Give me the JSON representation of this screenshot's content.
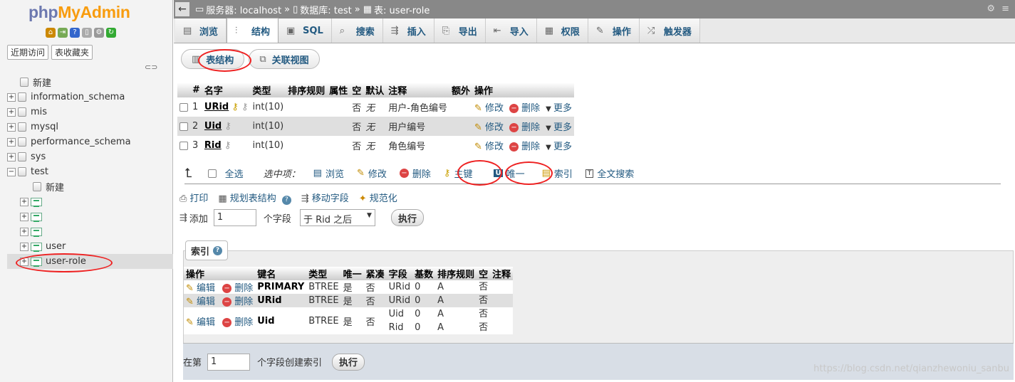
{
  "sidebar": {
    "logo_a": "php",
    "logo_b": "MyAdmin",
    "tab_recent": "近期访问",
    "tab_favorites": "表收藏夹",
    "tree": [
      {
        "label": "新建",
        "type": "new"
      },
      {
        "label": "information_schema",
        "type": "db"
      },
      {
        "label": "mis",
        "type": "db"
      },
      {
        "label": "mysql",
        "type": "db"
      },
      {
        "label": "performance_schema",
        "type": "db"
      },
      {
        "label": "sys",
        "type": "db"
      },
      {
        "label": "test",
        "type": "db-open"
      },
      {
        "label": "新建",
        "type": "new-child"
      },
      {
        "label": "",
        "type": "table"
      },
      {
        "label": "",
        "type": "table"
      },
      {
        "label": "",
        "type": "table"
      },
      {
        "label": "user",
        "type": "table"
      },
      {
        "label": "user-role",
        "type": "table"
      }
    ]
  },
  "breadcrumb": {
    "server": "服务器: localhost",
    "database": "数据库: test",
    "table": "表: user-role"
  },
  "tabs": [
    {
      "label": "浏览",
      "icon": "browse-icon",
      "glyph": "▤"
    },
    {
      "label": "结构",
      "icon": "structure-icon",
      "glyph": "⫶"
    },
    {
      "label": "SQL",
      "icon": "sql-icon",
      "glyph": "▣"
    },
    {
      "label": "搜索",
      "icon": "search-icon",
      "glyph": "⌕"
    },
    {
      "label": "插入",
      "icon": "insert-icon",
      "glyph": "⇶"
    },
    {
      "label": "导出",
      "icon": "export-icon",
      "glyph": "⎘"
    },
    {
      "label": "导入",
      "icon": "import-icon",
      "glyph": "⇤"
    },
    {
      "label": "权限",
      "icon": "privileges-icon",
      "glyph": "▦"
    },
    {
      "label": "操作",
      "icon": "operations-icon",
      "glyph": "✎"
    },
    {
      "label": "触发器",
      "icon": "triggers-icon",
      "glyph": "⤮"
    }
  ],
  "subtabs": {
    "structure": "表结构",
    "relation": "关联视图"
  },
  "structure_table": {
    "headers": [
      "#",
      "名字",
      "类型",
      "排序规则",
      "属性",
      "空",
      "默认",
      "注释",
      "额外",
      "操作"
    ],
    "rows": [
      {
        "num": "1",
        "name": "URid",
        "type": "int(10)",
        "null": "否",
        "default": "无",
        "comment": "用户-角色编号"
      },
      {
        "num": "2",
        "name": "Uid",
        "type": "int(10)",
        "null": "否",
        "default": "无",
        "comment": "用户编号"
      },
      {
        "num": "3",
        "name": "Rid",
        "type": "int(10)",
        "null": "否",
        "default": "无",
        "comment": "角色编号"
      }
    ],
    "edit": "修改",
    "drop": "删除",
    "more": "更多"
  },
  "bulk": {
    "select_all": "全选",
    "with_selected": "选中项：",
    "browse": "浏览",
    "change": "修改",
    "drop": "删除",
    "primary": "主键",
    "unique": "唯一",
    "index": "索引",
    "fulltext": "全文搜索"
  },
  "ops": {
    "print": "打印",
    "propose": "规划表结构",
    "move": "移动字段",
    "normalize": "规范化"
  },
  "add": {
    "label": "添加",
    "value": "1",
    "unit": "个字段",
    "position": "于 Rid 之后",
    "go": "执行"
  },
  "indexes": {
    "legend": "索引",
    "headers": [
      "操作",
      "键名",
      "类型",
      "唯一",
      "紧凑",
      "字段",
      "基数",
      "排序规则",
      "空",
      "注释"
    ],
    "edit": "编辑",
    "drop": "删除",
    "rows": [
      {
        "key": "PRIMARY",
        "type": "BTREE",
        "unique": "是",
        "packed": "否",
        "fields": [
          "URid"
        ],
        "card": [
          "0"
        ],
        "coll": [
          "A"
        ],
        "null": [
          "否"
        ]
      },
      {
        "key": "URid",
        "type": "BTREE",
        "unique": "是",
        "packed": "否",
        "fields": [
          "URid"
        ],
        "card": [
          "0"
        ],
        "coll": [
          "A"
        ],
        "null": [
          "否"
        ]
      },
      {
        "key": "Uid",
        "type": "BTREE",
        "unique": "是",
        "packed": "否",
        "fields": [
          "Uid",
          "Rid"
        ],
        "card": [
          "0",
          "0"
        ],
        "coll": [
          "A",
          "A"
        ],
        "null": [
          "否",
          "否"
        ]
      }
    ],
    "create_prefix": "在第",
    "create_value": "1",
    "create_suffix": "个字段创建索引",
    "create_go": "执行"
  },
  "watermark": "https://blog.csdn.net/qianzhewoniu_sanbu",
  "colors": {
    "accent": "#235a81",
    "highlight_circle": "#e22222",
    "topbar": "#888888"
  }
}
